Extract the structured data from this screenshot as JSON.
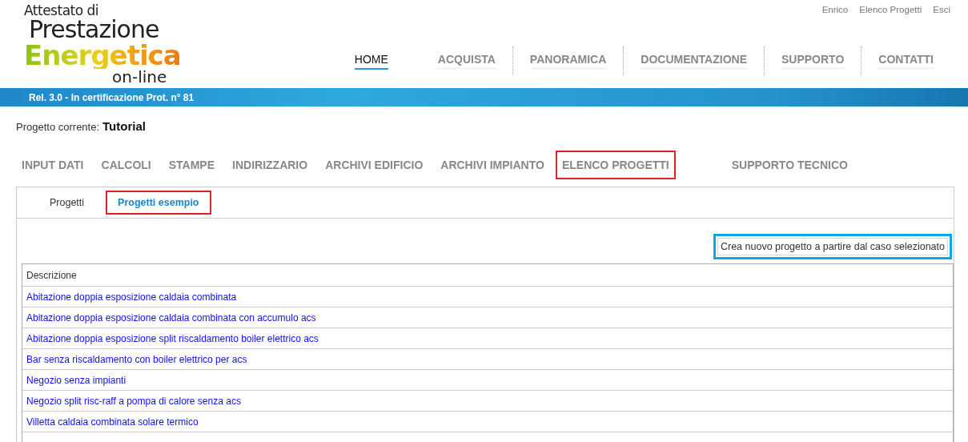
{
  "logo": {
    "line_1": "Attestato di",
    "line_2": "Prestazione",
    "line_3": "Energetica",
    "line_4": "on-line"
  },
  "user_links": [
    "Enrico",
    "Elenco Progetti",
    "Esci"
  ],
  "main_nav": [
    {
      "label": "HOME",
      "selected": true
    },
    {
      "label": "ACQUISTA",
      "selected": false
    },
    {
      "label": "PANORAMICA",
      "selected": false
    },
    {
      "label": "DOCUMENTAZIONE",
      "selected": false
    },
    {
      "label": "SUPPORTO",
      "selected": false
    },
    {
      "label": "CONTATTI",
      "selected": false
    }
  ],
  "release_bar": "Rel. 3.0 - In certificazione Prot. n° 81",
  "current_project": {
    "label": "Progetto corrente:",
    "value": "Tutorial"
  },
  "app_menu": [
    {
      "label": "INPUT DATI",
      "highlighted": false
    },
    {
      "label": "CALCOLI",
      "highlighted": false
    },
    {
      "label": "STAMPE",
      "highlighted": false
    },
    {
      "label": "INDIRIZZARIO",
      "highlighted": false
    },
    {
      "label": "ARCHIVI EDIFICIO",
      "highlighted": false
    },
    {
      "label": "ARCHIVI IMPIANTO",
      "highlighted": false
    },
    {
      "label": "ELENCO PROGETTI",
      "highlighted": true
    },
    {
      "label": "SUPPORTO TECNICO",
      "highlighted": false
    }
  ],
  "tabs": [
    {
      "label": "Progetti",
      "selected": false,
      "highlighted": false
    },
    {
      "label": "Progetti esempio",
      "selected": true,
      "highlighted": true
    }
  ],
  "create_button": {
    "label": "Crea nuovo progetto a partire dal caso selezionato",
    "highlighted": true
  },
  "table": {
    "columns": [
      "Descrizione"
    ],
    "rows": [
      "Abitazione doppia esposizione caldaia combinata",
      "Abitazione doppia esposizione caldaia combinata con accumulo acs",
      "Abitazione doppia esposizione split riscaldamento boiler elettrico acs",
      "Bar senza riscaldamento con boiler elettrico per acs",
      "Negozio senza impianti",
      "Negozio split risc-raff a pompa di calore senza acs",
      "Villetta caldaia combinata solare termico"
    ]
  }
}
